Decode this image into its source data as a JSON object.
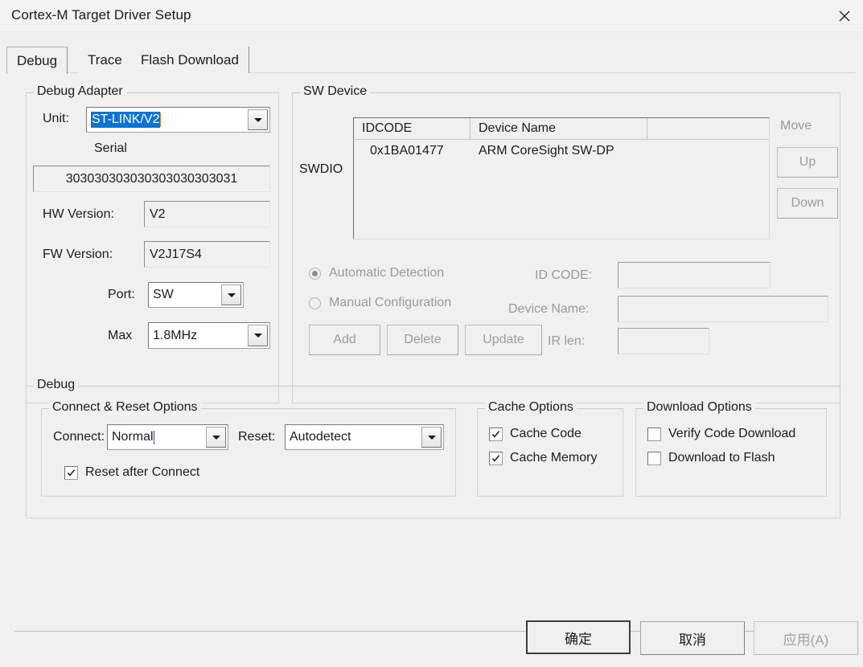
{
  "window": {
    "title": "Cortex-M Target Driver Setup",
    "close_icon": "close-icon"
  },
  "tabs": [
    {
      "label": "Debug",
      "active": true
    },
    {
      "label": "Trace",
      "active": false
    },
    {
      "label": "Flash Download",
      "active": false
    }
  ],
  "debug_adapter": {
    "group_label": "Debug Adapter",
    "unit_label": "Unit:",
    "unit_value": "ST-LINK/V2",
    "serial_label": "Serial",
    "serial_value": "303030303030303030303031",
    "hw_version_label": "HW Version:",
    "hw_version_value": "V2",
    "fw_version_label": "FW Version:",
    "fw_version_value": "V2J17S4",
    "port_label": "Port:",
    "port_value": "SW",
    "max_label": "Max",
    "max_value": "1.8MHz"
  },
  "sw_device": {
    "group_label": "SW Device",
    "line_label": "SWDIO",
    "columns": [
      "IDCODE",
      "Device Name",
      ""
    ],
    "rows": [
      {
        "idcode": "0x1BA01477",
        "device_name": "ARM CoreSight SW-DP"
      }
    ],
    "move_label": "Move",
    "up_label": "Up",
    "down_label": "Down",
    "automatic_detection_label": "Automatic Detection",
    "manual_configuration_label": "Manual Configuration",
    "detection_selected": "Automatic Detection",
    "add_label": "Add",
    "delete_label": "Delete",
    "update_label": "Update",
    "id_code_label": "ID CODE:",
    "id_code_value": "",
    "device_name_label": "Device Name:",
    "device_name_value": "",
    "ir_len_label": "IR len:",
    "ir_len_value": ""
  },
  "debug": {
    "group_label": "Debug",
    "connect_reset": {
      "group_label": "Connect & Reset Options",
      "connect_label": "Connect:",
      "connect_value": "Normal",
      "reset_label": "Reset:",
      "reset_value": "Autodetect",
      "reset_after_connect_label": "Reset after Connect",
      "reset_after_connect_checked": true
    },
    "cache_options": {
      "group_label": "Cache Options",
      "cache_code_label": "Cache Code",
      "cache_code_checked": true,
      "cache_memory_label": "Cache Memory",
      "cache_memory_checked": true
    },
    "download_options": {
      "group_label": "Download Options",
      "verify_code_download_label": "Verify Code Download",
      "verify_code_download_checked": false,
      "download_to_flash_label": "Download to Flash",
      "download_to_flash_checked": false
    }
  },
  "footer": {
    "ok_label": "确定",
    "cancel_label": "取消",
    "apply_label": "应用(A)"
  },
  "colors": {
    "selection_blue": "#0a73d4",
    "dialog_bg": "#f0f0f0",
    "titlebar_bg": "#f3f3f3",
    "disabled_text": "#9a9a9a",
    "text": "#1b1b1b"
  }
}
